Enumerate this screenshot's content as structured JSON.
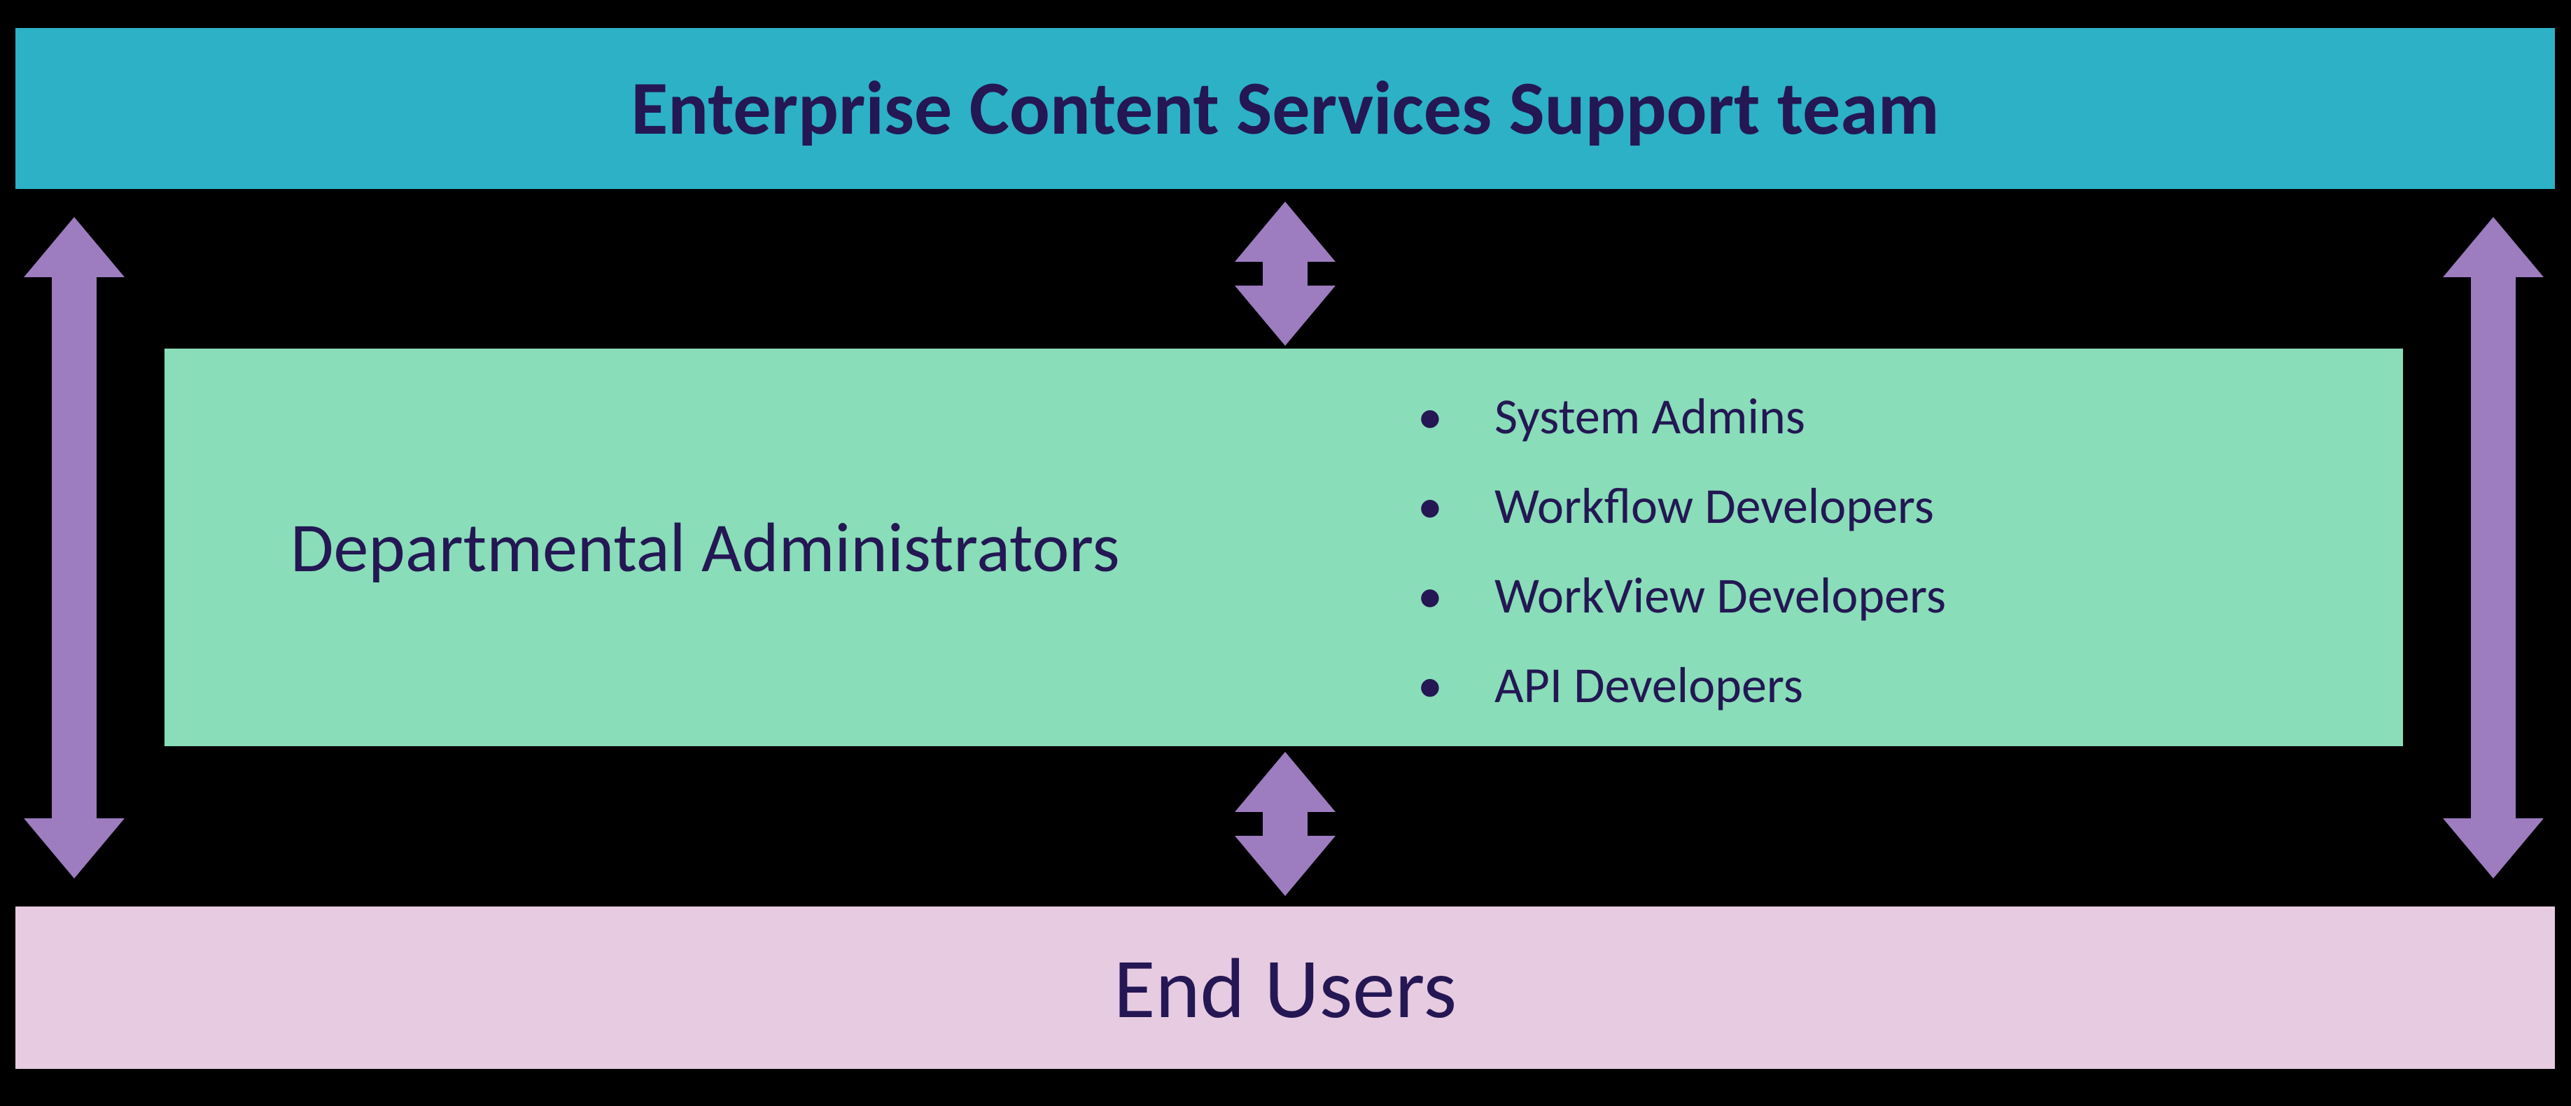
{
  "top": {
    "label": "Enterprise Content Services Support team"
  },
  "middle": {
    "title": "Departmental Administrators",
    "bullets": [
      "System Admins",
      "Workflow Developers",
      "WorkView Developers",
      "API Developers"
    ]
  },
  "bottom": {
    "label": "End Users"
  },
  "colors": {
    "top_bg": "#2cb1c6",
    "mid_bg": "#89ddb8",
    "bottom_bg": "#e7cbe1",
    "arrow": "#9d7cbf",
    "text": "#241754"
  }
}
